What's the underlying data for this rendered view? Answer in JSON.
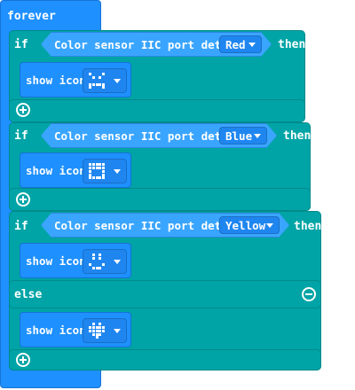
{
  "forever": {
    "label": "forever"
  },
  "blocks": [
    {
      "if_label": "if",
      "condition": "Color sensor IIC port detects",
      "color_value": "Red",
      "then_label": "then",
      "show_label": "show icon",
      "icon": "sad-face-icon"
    },
    {
      "if_label": "if",
      "condition": "Color sensor IIC port detects",
      "color_value": "Blue",
      "then_label": "then",
      "show_label": "show icon",
      "icon": "square-grid-icon"
    },
    {
      "if_label": "if",
      "condition": "Color sensor IIC port detects",
      "color_value": "Yellow",
      "then_label": "then",
      "show_label": "show icon",
      "icon": "happy-face-icon",
      "else_label": "else",
      "else_show_label": "show icon",
      "else_icon": "heart-icon"
    }
  ],
  "colors": {
    "blue_block": "#1E90FF",
    "teal_block": "#00A4A6",
    "condition_block": "#3AA5FF"
  }
}
